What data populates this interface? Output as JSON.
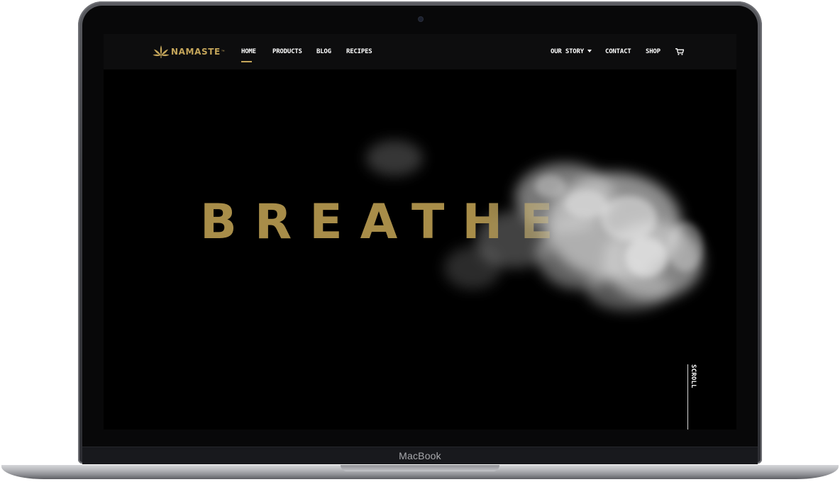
{
  "device": {
    "label": "MacBook"
  },
  "header": {
    "logo_text": "NAMASTE",
    "logo_icon": "cannabis-leaf-icon",
    "nav_left": [
      {
        "label": "HOME",
        "active": true
      },
      {
        "label": "PRODUCTS"
      },
      {
        "label": "BLOG"
      },
      {
        "label": "RECIPES"
      }
    ],
    "nav_right": [
      {
        "label": "OUR STORY",
        "has_dropdown": true
      },
      {
        "label": "CONTACT"
      },
      {
        "label": "SHOP"
      }
    ],
    "cart_icon": "shopping-cart-icon"
  },
  "hero": {
    "title": "BREATHE",
    "scroll_label": "SCROLL"
  },
  "colors": {
    "accent_gold": "#c4a55a",
    "hero_text": "#a88d49",
    "nav_background": "#0d0d0e",
    "screen_background": "#000000"
  }
}
